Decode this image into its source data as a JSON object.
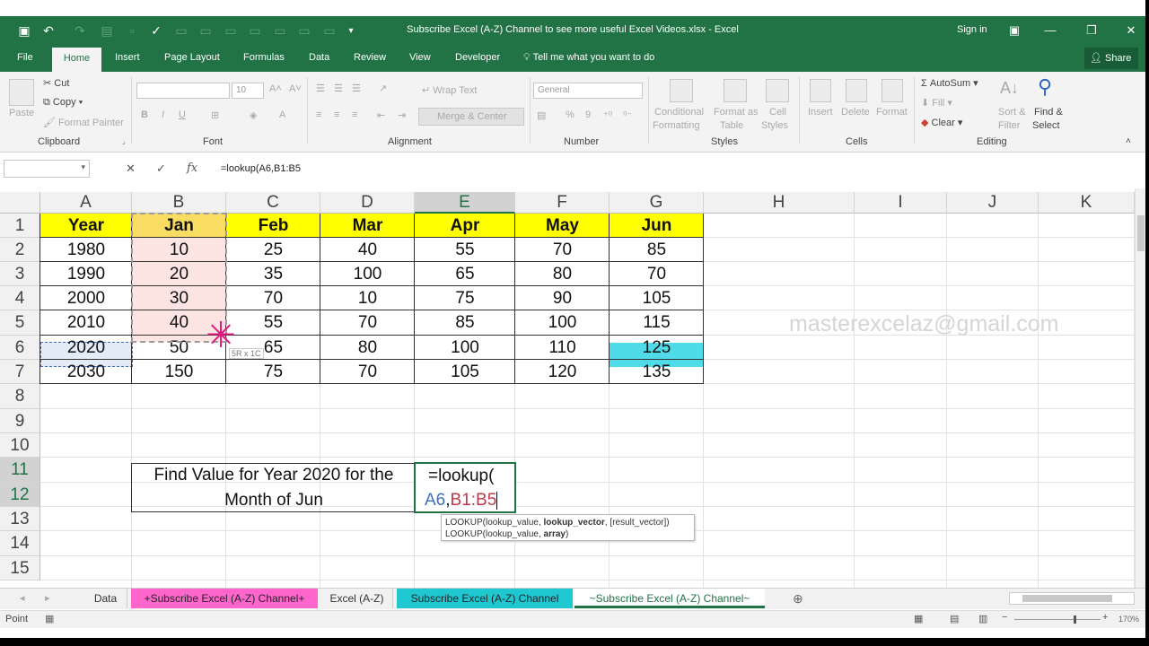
{
  "window": {
    "title": "Subscribe Excel (A-Z) Channel to see more useful Excel Videos.xlsx - Excel",
    "sign_in": "Sign in"
  },
  "tabs": [
    "File",
    "Home",
    "Insert",
    "Page Layout",
    "Formulas",
    "Data",
    "Review",
    "View",
    "Developer"
  ],
  "tell_me": "Tell me what you want to do",
  "share": "Share",
  "ribbon": {
    "clipboard": {
      "label": "Clipboard",
      "paste": "Paste",
      "cut": "Cut",
      "copy": "Copy",
      "format_painter": "Format Painter"
    },
    "font": {
      "label": "Font",
      "size": "10",
      "bold": "B",
      "italic": "I",
      "underline": "U"
    },
    "alignment": {
      "label": "Alignment",
      "wrap": "Wrap Text",
      "merge": "Merge & Center"
    },
    "number": {
      "label": "Number",
      "format": "General",
      "percent": "%",
      "comma": "9"
    },
    "styles": {
      "label": "Styles",
      "cond1": "Conditional",
      "cond2": "Formatting",
      "fat1": "Format as",
      "fat2": "Table",
      "cs1": "Cell",
      "cs2": "Styles"
    },
    "cells": {
      "label": "Cells",
      "insert": "Insert",
      "delete": "Delete",
      "format": "Format"
    },
    "editing": {
      "label": "Editing",
      "autosum": "AutoSum",
      "fill": "Fill",
      "clear": "Clear",
      "sort1": "Sort &",
      "sort2": "Filter",
      "find1": "Find &",
      "find2": "Select"
    }
  },
  "formula_bar": {
    "formula": "=lookup(A6,B1:B5",
    "cancel": "✕",
    "enter": "✓",
    "fx": "fx"
  },
  "columns": [
    "A",
    "B",
    "C",
    "D",
    "E",
    "F",
    "G",
    "H",
    "I",
    "J",
    "K"
  ],
  "rows": [
    "1",
    "2",
    "3",
    "4",
    "5",
    "6",
    "7",
    "8",
    "9",
    "10",
    "11",
    "12",
    "13",
    "14",
    "15"
  ],
  "table": {
    "header": [
      "Year",
      "Jan",
      "Feb",
      "Mar",
      "Apr",
      "May",
      "Jun"
    ],
    "body": [
      [
        "1980",
        "10",
        "25",
        "40",
        "55",
        "70",
        "85"
      ],
      [
        "1990",
        "20",
        "35",
        "100",
        "65",
        "80",
        "70"
      ],
      [
        "2000",
        "30",
        "70",
        "10",
        "75",
        "90",
        "105"
      ],
      [
        "2010",
        "40",
        "55",
        "70",
        "85",
        "100",
        "115"
      ],
      [
        "2020",
        "50",
        "65",
        "80",
        "100",
        "110",
        "125"
      ],
      [
        "2030",
        "150",
        "75",
        "70",
        "105",
        "120",
        "135"
      ]
    ]
  },
  "question": {
    "line1": "Find Value for Year 2020 for the",
    "line2": "Month of Jun"
  },
  "editing_cell": {
    "line1": "=lookup(",
    "ref1": "A6",
    "comma": ",",
    "ref2": "B1:B5"
  },
  "tooltip": {
    "line1_pre": "LOOKUP(lookup_value, ",
    "line1_bold": "lookup_vector",
    "line1_post": ", [result_vector])",
    "line2_pre": "LOOKUP(lookup_value, ",
    "line2_bold": "array",
    "line2_post": ")"
  },
  "selection_size": "5R x 1C",
  "watermark": "masterexcelaz@gmail.com",
  "sheets": [
    "Data",
    "+Subscribe Excel (A-Z) Channel+",
    "Excel (A-Z)",
    "Subscribe Excel (A-Z) Channel",
    "~Subscribe Excel (A-Z) Channel~"
  ],
  "status": {
    "mode": "Point",
    "zoom": "170%"
  },
  "colors": {
    "excel_green": "#217346",
    "header_yellow": "#ffff00",
    "highlight_cyan": "#4fdce8",
    "pink_tab": "#ff66cc",
    "teal_tab": "#1fc8d0",
    "ref_blue": "#3f6fc4",
    "ref_red": "#c0394b"
  }
}
